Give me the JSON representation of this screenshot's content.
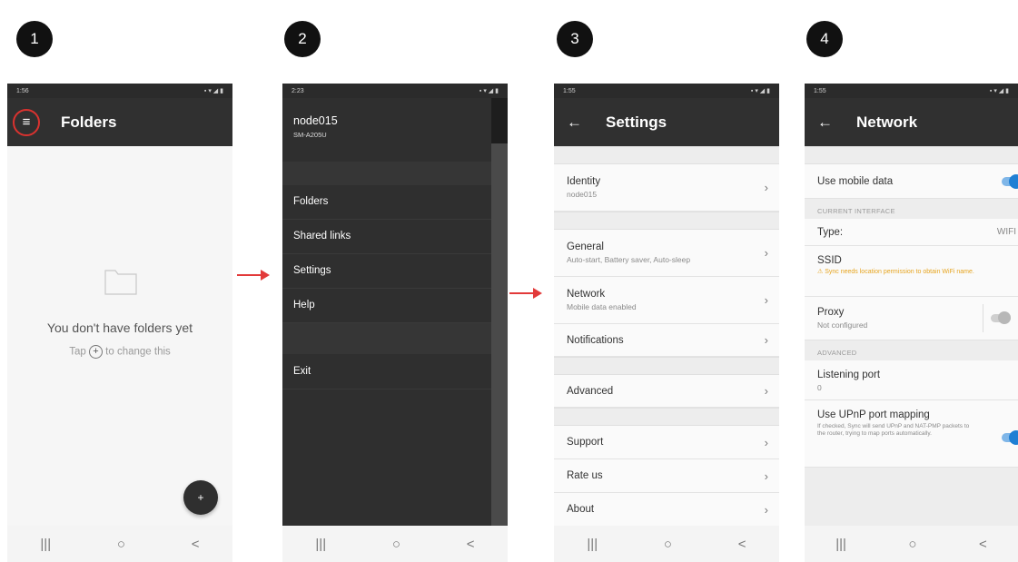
{
  "steps": [
    "1",
    "2",
    "3",
    "4"
  ],
  "phone1": {
    "status_time": "1:56",
    "title": "Folders",
    "empty_title": "You don't have folders yet",
    "empty_hint_before": "Tap",
    "empty_hint_after": "to change this",
    "fab_label": "+"
  },
  "phone2": {
    "status_time": "2:23",
    "device_name": "node015",
    "device_model": "SM-A205U",
    "menu": [
      "Folders",
      "Shared links",
      "Settings",
      "Help"
    ],
    "exit_label": "Exit"
  },
  "phone3": {
    "status_time": "1:55",
    "title": "Settings",
    "identity": {
      "title": "Identity",
      "subtitle": "node015"
    },
    "general": {
      "title": "General",
      "subtitle": "Auto-start, Battery saver, Auto-sleep"
    },
    "network": {
      "title": "Network",
      "subtitle": "Mobile data enabled"
    },
    "notifications": {
      "title": "Notifications"
    },
    "advanced": {
      "title": "Advanced"
    },
    "support": {
      "title": "Support"
    },
    "rate": {
      "title": "Rate us"
    },
    "about": {
      "title": "About"
    }
  },
  "phone4": {
    "status_time": "1:55",
    "title": "Network",
    "mobile_data_label": "Use mobile data",
    "current_interface_header": "CURRENT INTERFACE",
    "type_label": "Type:",
    "type_value": "WIFI",
    "ssid_label": "SSID",
    "ssid_warning": "⚠ Sync needs location permission to obtain WiFi name.",
    "proxy_label": "Proxy",
    "proxy_value": "Not configured",
    "advanced_header": "ADVANCED",
    "port_label": "Listening port",
    "port_value": "0",
    "upnp_label": "Use UPnP port mapping",
    "upnp_desc": "If checked, Sync will send UPnP and NAT-PMP packets to the router, trying to map ports automatically."
  },
  "navbar": {
    "recents": "|||",
    "home": "○",
    "back": "<"
  },
  "colors": {
    "accent": "#1f7fd4",
    "arrow": "#e23a3a",
    "highlight_circle": "#d9322f",
    "warning": "#e6a41e"
  }
}
